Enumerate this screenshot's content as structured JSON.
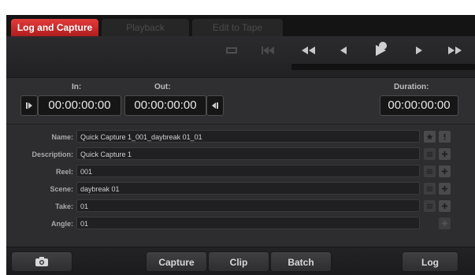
{
  "tabs": [
    {
      "label": "Log and Capture",
      "active": true
    },
    {
      "label": "Playback",
      "active": false
    },
    {
      "label": "Edit to Tape",
      "active": false
    }
  ],
  "transport": {
    "icons": [
      "loop-icon",
      "go-to-start-icon",
      "fast-rewind-icon",
      "step-back-icon",
      "play-icon",
      "step-forward-icon",
      "fast-forward-icon"
    ]
  },
  "timecode": {
    "in_label": "In:",
    "out_label": "Out:",
    "duration_label": "Duration:",
    "in_value": "00:00:00:00",
    "out_value": "00:00:00:00",
    "duration_value": "00:00:00:00"
  },
  "fields": {
    "name_label": "Name:",
    "name_value": "Quick Capture 1_001_daybreak 01_01",
    "description_label": "Description:",
    "description_value": "Quick Capture 1",
    "reel_label": "Reel:",
    "reel_value": "001",
    "scene_label": "Scene:",
    "scene_value": "daybreak 01",
    "take_label": "Take:",
    "take_value": "01",
    "angle_label": "Angle:",
    "angle_value": "01"
  },
  "bottom": {
    "capture_label": "Capture",
    "clip_label": "Clip",
    "batch_label": "Batch",
    "log_label": "Log"
  },
  "colors": {
    "accent_red": "#cc2a2a",
    "panel": "#2d2d2f",
    "field_bg": "#202022"
  }
}
